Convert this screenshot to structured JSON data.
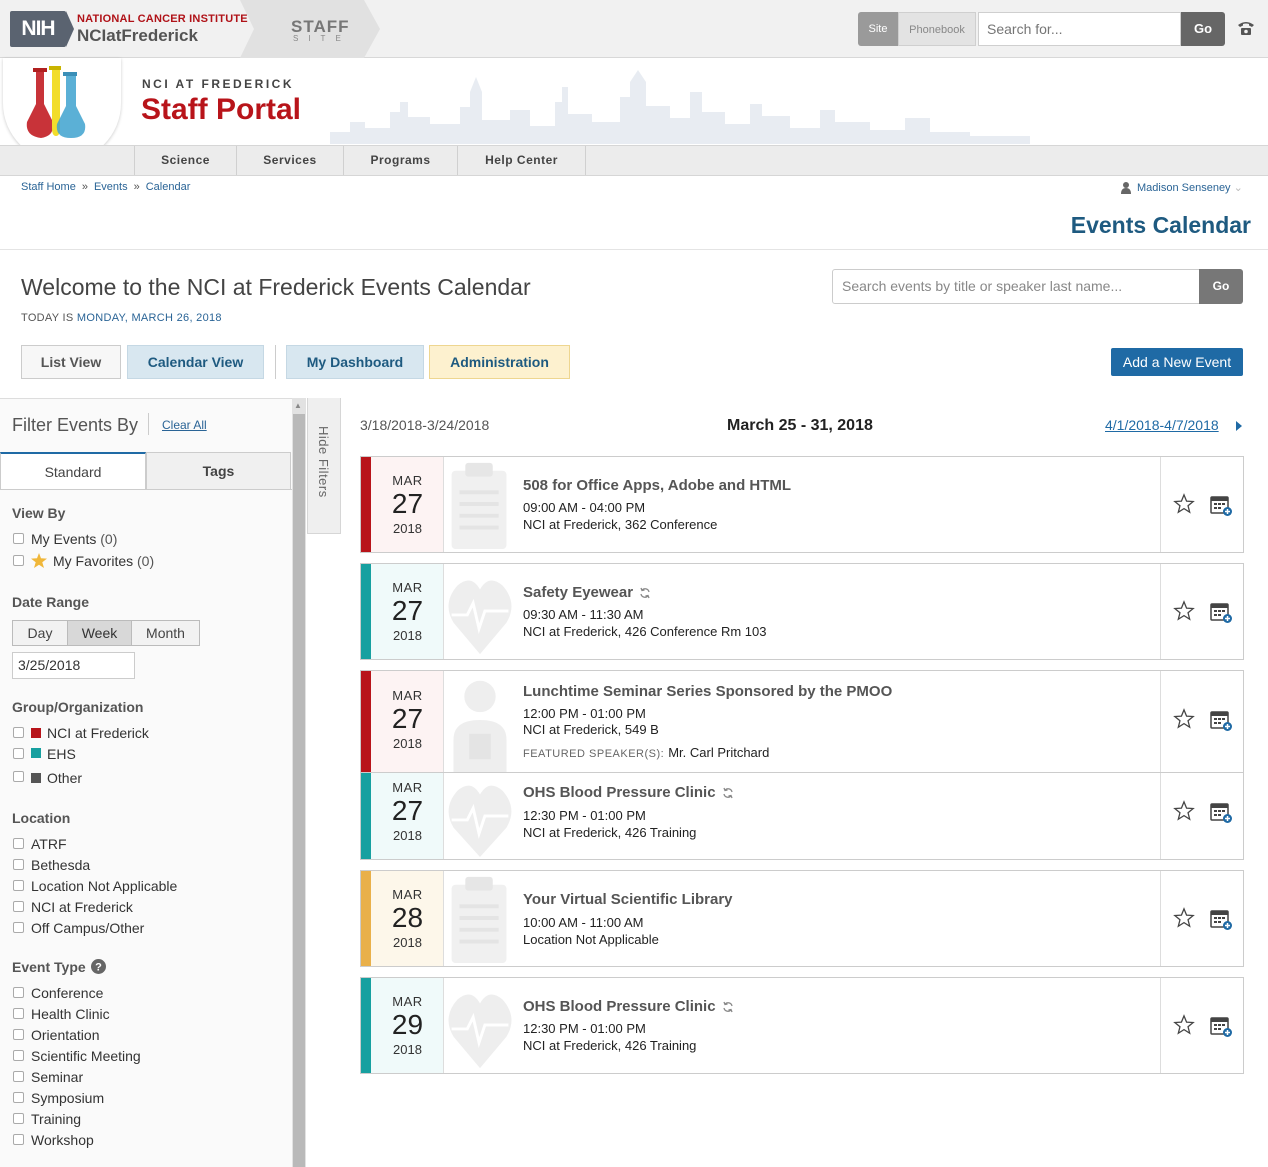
{
  "topbar": {
    "nih": "NIH",
    "org": "NATIONAL CANCER INSTITUTE",
    "site_name": "NCIatFrederick",
    "staff": "STAFF",
    "staff_sub": "SITE",
    "site_btn": "Site",
    "phonebook_btn": "Phonebook",
    "search_placeholder": "Search for...",
    "go": "Go"
  },
  "header": {
    "overline": "NCI AT FREDERICK",
    "title": "Staff Portal"
  },
  "nav": [
    "Science",
    "Services",
    "Programs",
    "Help Center"
  ],
  "breadcrumb": [
    "Staff Home",
    "Events",
    "Calendar"
  ],
  "user": "Madison Senseney",
  "page_title": "Events Calendar",
  "welcome": "Welcome to the NCI at Frederick Events Calendar",
  "today_prefix": "TODAY IS",
  "today_date": "MONDAY, MARCH 26, 2018",
  "event_search": {
    "placeholder": "Search events by title or speaker last name...",
    "go": "Go"
  },
  "views": {
    "list": "List View",
    "calendar": "Calendar View",
    "dashboard": "My Dashboard",
    "admin": "Administration",
    "add": "Add a New Event"
  },
  "colors": {
    "nci_red": "#b8141a",
    "ehs_teal": "#17a0a0",
    "other_orange": "#e9b04a",
    "link_blue": "#1f6aa5"
  },
  "filters": {
    "title": "Filter Events By",
    "clear": "Clear All",
    "tabs": [
      "Standard",
      "Tags"
    ],
    "hide": "Hide Filters",
    "view_by": {
      "head": "View By",
      "items": [
        {
          "label": "My Events",
          "count": "(0)"
        },
        {
          "label": "My Favorites",
          "count": "(0)"
        }
      ]
    },
    "date_range": {
      "head": "Date Range",
      "buttons": [
        "Day",
        "Week",
        "Month"
      ],
      "value": "3/25/2018"
    },
    "group": {
      "head": "Group/Organization",
      "items": [
        "NCI at Frederick",
        "EHS",
        "Other"
      ]
    },
    "location": {
      "head": "Location",
      "items": [
        "ATRF",
        "Bethesda",
        "Location Not Applicable",
        "NCI at Frederick",
        "Off Campus/Other"
      ]
    },
    "event_type": {
      "head": "Event Type",
      "items": [
        "Conference",
        "Health Clinic",
        "Orientation",
        "Scientific Meeting",
        "Seminar",
        "Symposium",
        "Training",
        "Workshop"
      ]
    }
  },
  "week_nav": {
    "prev": "3/18/2018-3/24/2018",
    "current": "March 25 - 31, 2018",
    "next": "4/1/2018-4/7/2018"
  },
  "events": [
    {
      "mon": "MAR",
      "day": "27",
      "year": "2018",
      "title": "508 for Office Apps, Adobe and HTML",
      "time": "09:00 AM - 04:00 PM",
      "location": "NCI at Frederick, 362 Conference",
      "icon": "clipboard-icon"
    },
    {
      "mon": "MAR",
      "day": "27",
      "year": "2018",
      "title": "Safety Eyewear",
      "time": "09:30 AM - 11:30 AM",
      "location": "NCI at Frederick, 426 Conference Rm 103",
      "icon": "heart-icon",
      "recurring": true
    },
    {
      "mon": "MAR",
      "day": "27",
      "year": "2018",
      "title": "Lunchtime Seminar Series Sponsored by the PMOO",
      "time": "12:00 PM - 01:00 PM",
      "location": "NCI at Frederick, 549 B",
      "speaker_label": "FEATURED SPEAKER(S):",
      "speaker": "Mr. Carl Pritchard",
      "icon": "speaker-icon"
    },
    {
      "mon": "MAR",
      "day": "27",
      "year": "2018",
      "title": "OHS Blood Pressure Clinic",
      "time": "12:30 PM - 01:00 PM",
      "location": "NCI at Frederick, 426 Training",
      "icon": "heart-icon",
      "recurring": true
    },
    {
      "mon": "MAR",
      "day": "28",
      "year": "2018",
      "title": "Your Virtual Scientific Library",
      "time": "10:00 AM - 11:00 AM",
      "location": "Location Not Applicable",
      "icon": "clipboard-icon"
    },
    {
      "mon": "MAR",
      "day": "29",
      "year": "2018",
      "title": "OHS Blood Pressure Clinic",
      "time": "12:30 PM - 01:00 PM",
      "location": "NCI at Frederick, 426 Training",
      "icon": "heart-icon",
      "recurring": true
    }
  ]
}
